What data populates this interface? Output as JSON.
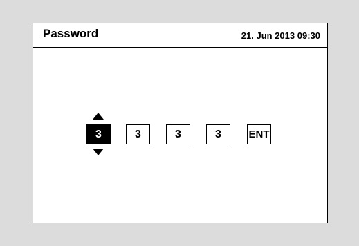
{
  "header": {
    "title": "Password",
    "datetime": "21. Jun 2013 09:30"
  },
  "password": {
    "digits": [
      "3",
      "3",
      "3",
      "3"
    ],
    "selected_index": 0,
    "enter_label": "ENT"
  },
  "icons": {
    "increment": "triangle-up-icon",
    "decrement": "triangle-down-icon"
  },
  "colors": {
    "background": "#dcdcdc",
    "screen": "#ffffff",
    "border": "#000000",
    "selected_fill": "#000000",
    "selected_text": "#ffffff"
  }
}
